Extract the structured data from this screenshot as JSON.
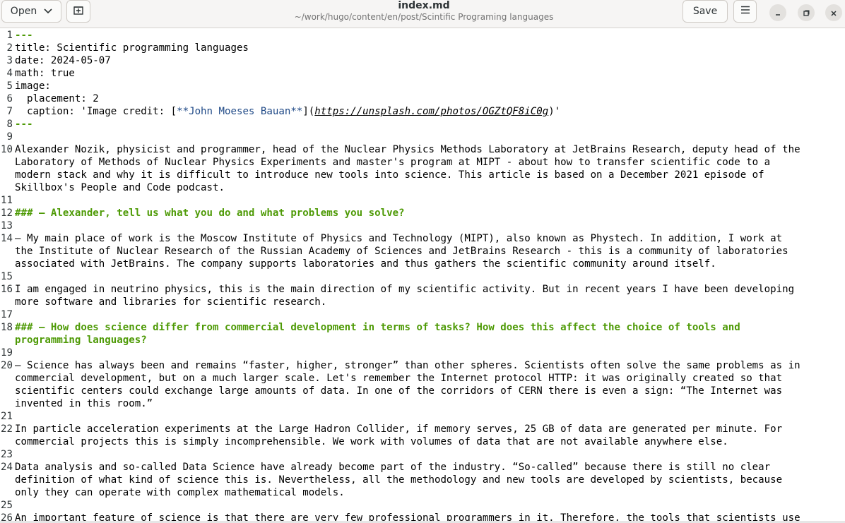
{
  "header": {
    "open_label": "Open",
    "title": "index.md",
    "subtitle": "~/work/hugo/content/en/post/Scintific Programing languages",
    "save_label": "Save",
    "icons": {
      "dropdown": "chevron-down-icon",
      "new_tab": "new-tab-icon",
      "menu": "hamburger-menu-icon",
      "minimize": "minimize-icon",
      "maximize": "maximize-icon",
      "close": "close-icon"
    }
  },
  "editor": {
    "lines": [
      {
        "n": "1",
        "rows": [
          [
            {
              "t": "---",
              "c": "fm"
            }
          ]
        ]
      },
      {
        "n": "2",
        "rows": [
          [
            {
              "t": "title: Scientific programming languages"
            }
          ]
        ]
      },
      {
        "n": "3",
        "rows": [
          [
            {
              "t": "date: 2024-05-07"
            }
          ]
        ]
      },
      {
        "n": "4",
        "rows": [
          [
            {
              "t": "math: true"
            }
          ]
        ]
      },
      {
        "n": "5",
        "rows": [
          [
            {
              "t": "image:"
            }
          ]
        ]
      },
      {
        "n": "6",
        "rows": [
          [
            {
              "t": "  placement: 2"
            }
          ]
        ]
      },
      {
        "n": "7",
        "rows": [
          [
            {
              "t": "  caption: 'Image credit: ["
            },
            {
              "t": "**John Moeses Bauan**",
              "c": "lk"
            },
            {
              "t": "]("
            },
            {
              "t": "https://unsplash.com/photos/OGZtQF8iC0g",
              "c": "url"
            },
            {
              "t": ")'"
            }
          ]
        ]
      },
      {
        "n": "8",
        "rows": [
          [
            {
              "t": "---",
              "c": "fm"
            }
          ]
        ]
      },
      {
        "n": "9",
        "rows": [
          [
            {
              "t": ""
            }
          ]
        ]
      },
      {
        "n": "10",
        "rows": [
          [
            {
              "t": "Alexander Nozik, physicist and programmer, head of the Nuclear Physics Methods Laboratory at JetBrains Research, deputy head of the"
            }
          ],
          [
            {
              "t": "Laboratory of Methods of Nuclear Physics Experiments and master's program at MIPT - about how to transfer scientific code to a"
            }
          ],
          [
            {
              "t": "modern stack and why it is difficult to introduce new tools into science. This article is based on a December 2021 episode of"
            }
          ],
          [
            {
              "t": "Skillbox's People and Code podcast."
            }
          ]
        ]
      },
      {
        "n": "11",
        "rows": [
          [
            {
              "t": ""
            }
          ]
        ]
      },
      {
        "n": "12",
        "rows": [
          [
            {
              "t": "### — Alexander, tell us what you do and what problems you solve?",
              "c": "hd"
            }
          ]
        ]
      },
      {
        "n": "13",
        "rows": [
          [
            {
              "t": ""
            }
          ]
        ]
      },
      {
        "n": "14",
        "rows": [
          [
            {
              "t": "— My main place of work is the Moscow Institute of Physics and Technology (MIPT), also known as Phystech. In addition, I work at"
            }
          ],
          [
            {
              "t": "the Institute of Nuclear Research of the Russian Academy of Sciences and JetBrains Research - this is a community of laboratories"
            }
          ],
          [
            {
              "t": "associated with JetBrains. The company supports laboratories and thus gathers the scientific community around itself."
            }
          ]
        ]
      },
      {
        "n": "15",
        "rows": [
          [
            {
              "t": ""
            }
          ]
        ]
      },
      {
        "n": "16",
        "rows": [
          [
            {
              "t": "I am engaged in neutrino physics, this is the main direction of my scientific activity. But in recent years I have been developing"
            }
          ],
          [
            {
              "t": "more software and libraries for scientific research."
            }
          ]
        ]
      },
      {
        "n": "17",
        "rows": [
          [
            {
              "t": ""
            }
          ]
        ]
      },
      {
        "n": "18",
        "rows": [
          [
            {
              "t": "### — How does science differ from commercial development in terms of tasks? How does this affect the choice of tools and",
              "c": "hd"
            }
          ],
          [
            {
              "t": "programming languages?",
              "c": "hd"
            }
          ]
        ]
      },
      {
        "n": "19",
        "rows": [
          [
            {
              "t": ""
            }
          ]
        ]
      },
      {
        "n": "20",
        "rows": [
          [
            {
              "t": "— Science has always been and remains “faster, higher, stronger” than other spheres. Scientists often solve the same problems as in"
            }
          ],
          [
            {
              "t": "commercial development, but on a much larger scale. Let's remember the Internet protocol HTTP: it was originally created so that"
            }
          ],
          [
            {
              "t": "scientific centers could exchange large amounts of data. In one of the corridors of CERN there is even a sign: “The Internet was"
            }
          ],
          [
            {
              "t": "invented in this room.”"
            }
          ]
        ]
      },
      {
        "n": "21",
        "rows": [
          [
            {
              "t": ""
            }
          ]
        ]
      },
      {
        "n": "22",
        "rows": [
          [
            {
              "t": "In particle acceleration experiments at the Large Hadron Collider, if memory serves, 25 GB of data are generated per minute. For"
            }
          ],
          [
            {
              "t": "commercial projects this is simply incomprehensible. We work with volumes of data that are not available anywhere else."
            }
          ]
        ]
      },
      {
        "n": "23",
        "rows": [
          [
            {
              "t": ""
            }
          ]
        ]
      },
      {
        "n": "24",
        "rows": [
          [
            {
              "t": "Data analysis and so-called Data Science have already become part of the industry. “So-called” because there is still no clear"
            }
          ],
          [
            {
              "t": "definition of what kind of science this is. Nevertheless, all the methodology and new tools are developed by scientists, because"
            }
          ],
          [
            {
              "t": "only they can operate with complex mathematical models."
            }
          ]
        ]
      },
      {
        "n": "25",
        "rows": [
          [
            {
              "t": ""
            }
          ]
        ]
      },
      {
        "n": "26",
        "rows": [
          [
            {
              "t": "An important feature of science is that there are very few professional programmers in it. Therefore, the tools that scientists use"
            }
          ]
        ]
      }
    ]
  }
}
